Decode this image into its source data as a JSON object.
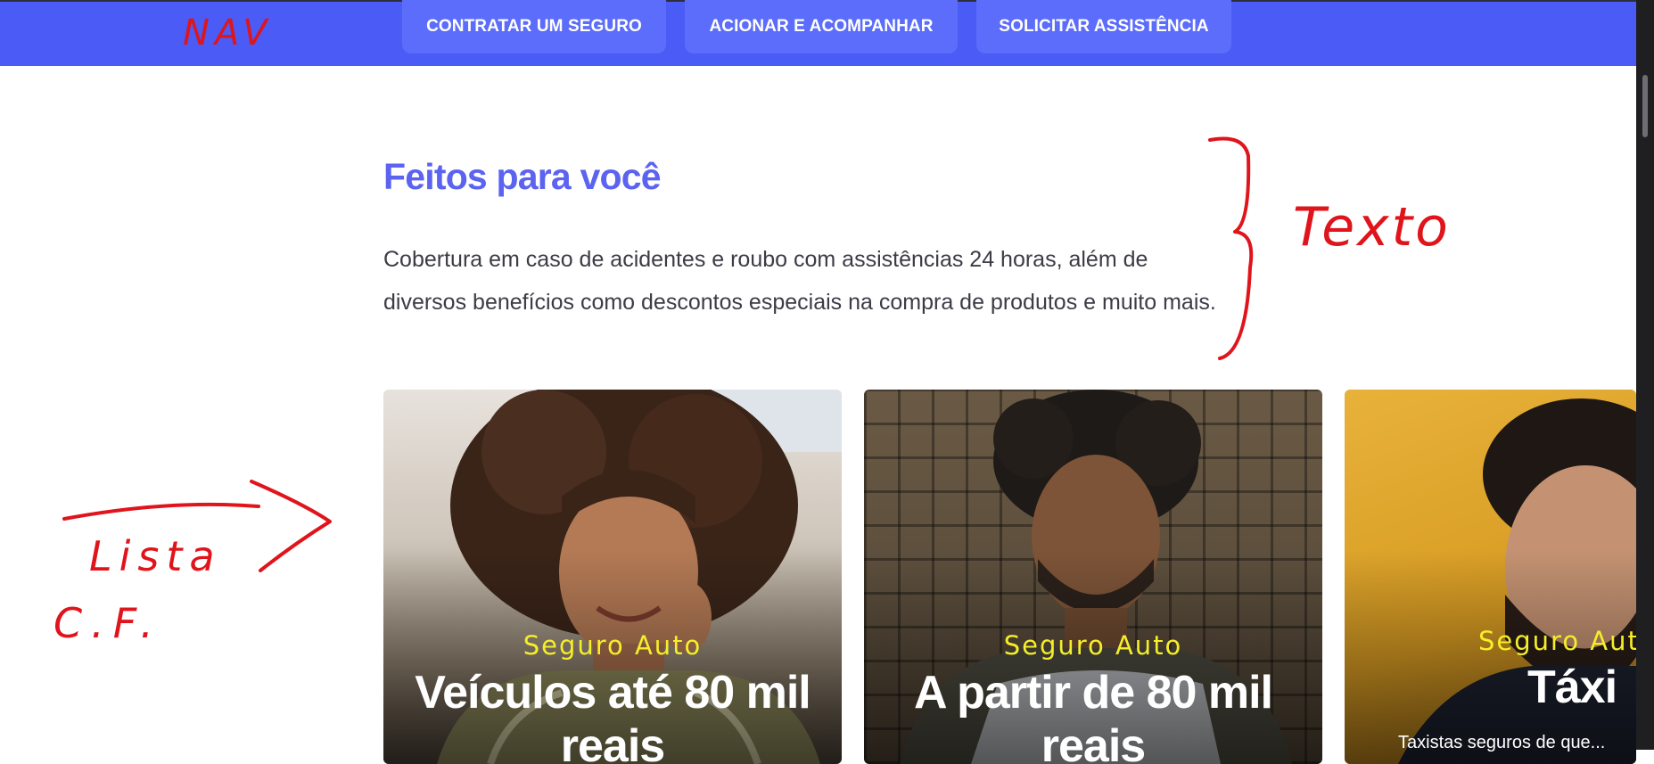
{
  "nav": {
    "items": [
      "CONTRATAR UM SEGURO",
      "ACIONAR E ACOMPANHAR",
      "SOLICITAR ASSISTÊNCIA"
    ]
  },
  "section": {
    "title": "Feitos para você",
    "description": "Cobertura em caso de acidentes e roubo com assistências 24 horas, além de diversos benefícios como descontos especiais na compra de produtos e muito mais."
  },
  "cards": [
    {
      "tag": "Seguro Auto",
      "headline": "Veículos até 80 mil reais"
    },
    {
      "tag": "Seguro Auto",
      "headline": "A partir de 80 mil reais"
    },
    {
      "tag": "Seguro Auto",
      "headline": "Táxi",
      "subtext": "Taxistas seguros de que..."
    }
  ],
  "annotations": {
    "nav": "NAV",
    "texto": "Texto",
    "lista": "Lista",
    "cf": "C.F."
  },
  "colors": {
    "nav_bg": "#4a5cf5",
    "title": "#5b63f0",
    "tag": "#f5ee2a",
    "annotation": "#e0141b"
  }
}
